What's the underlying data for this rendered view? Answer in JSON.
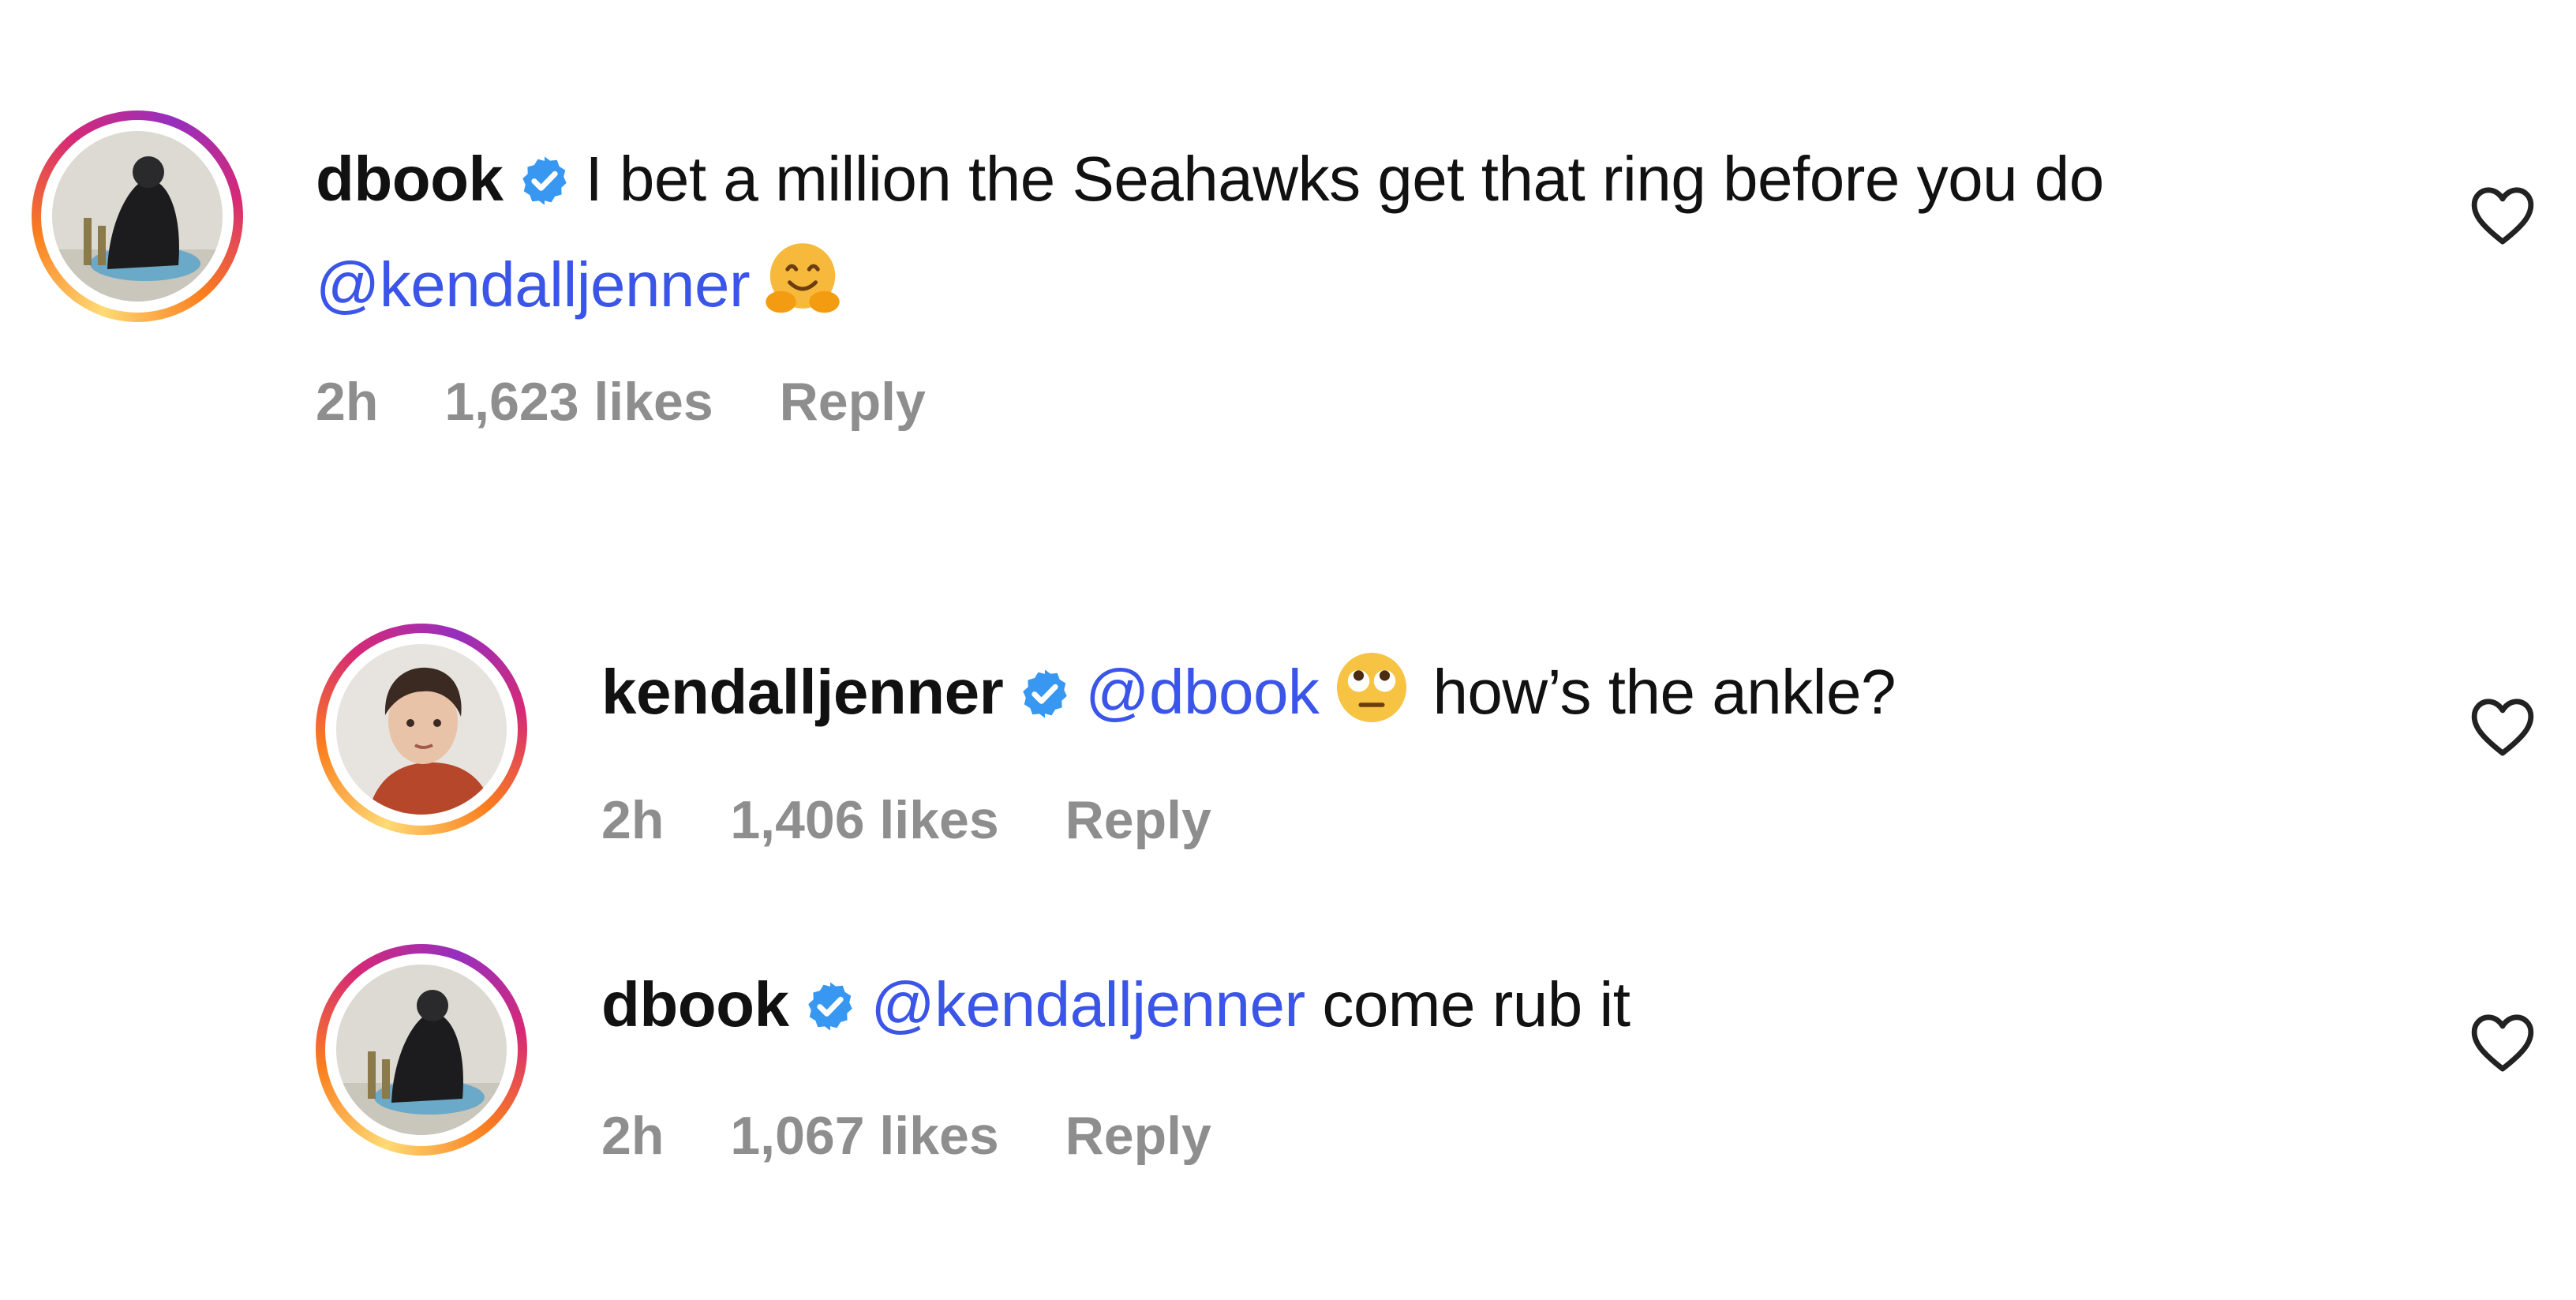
{
  "comments": [
    {
      "username": "dbook",
      "text_before": "I bet a million the Seahawks get that ring before you do",
      "mention": "@kendalljenner",
      "text_after": "",
      "emoji": "hugging-face-emoji",
      "time": "2h",
      "likes": "1,623 likes",
      "reply_label": "Reply"
    },
    {
      "username": "kendalljenner",
      "text_before": "",
      "mention": "@dbook",
      "text_after": "how’s the ankle?",
      "emoji": "face-with-rolling-eyes-emoji",
      "time": "2h",
      "likes": "1,406 likes",
      "reply_label": "Reply"
    },
    {
      "username": "dbook",
      "text_before": "",
      "mention": "@kendalljenner",
      "text_after": "come rub it",
      "time": "2h",
      "likes": "1,067 likes",
      "reply_label": "Reply"
    }
  ],
  "colors": {
    "mention": "#3a55e8",
    "verified": "#3897f0",
    "meta": "#8e8e8e",
    "text": "#111111"
  },
  "icons": {
    "like": "heart-outline-icon",
    "verified": "verified-badge-icon"
  }
}
